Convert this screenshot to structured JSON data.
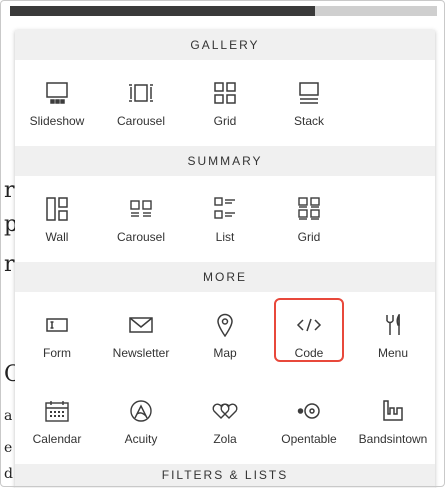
{
  "sections": {
    "gallery": {
      "header": "GALLERY",
      "items": [
        {
          "label": "Slideshow",
          "icon": "slideshow-icon"
        },
        {
          "label": "Carousel",
          "icon": "carousel-icon"
        },
        {
          "label": "Grid",
          "icon": "grid-icon"
        },
        {
          "label": "Stack",
          "icon": "stack-icon"
        }
      ]
    },
    "summary": {
      "header": "SUMMARY",
      "items": [
        {
          "label": "Wall",
          "icon": "wall-icon"
        },
        {
          "label": "Carousel",
          "icon": "summary-carousel-icon"
        },
        {
          "label": "List",
          "icon": "list-icon"
        },
        {
          "label": "Grid",
          "icon": "summary-grid-icon"
        }
      ]
    },
    "more": {
      "header": "MORE",
      "items": [
        {
          "label": "Form",
          "icon": "form-icon"
        },
        {
          "label": "Newsletter",
          "icon": "envelope-icon"
        },
        {
          "label": "Map",
          "icon": "map-pin-icon"
        },
        {
          "label": "Code",
          "icon": "code-icon",
          "highlighted": true
        },
        {
          "label": "Menu",
          "icon": "fork-knife-icon"
        },
        {
          "label": "Calendar",
          "icon": "calendar-icon"
        },
        {
          "label": "Acuity",
          "icon": "acuity-icon"
        },
        {
          "label": "Zola",
          "icon": "zola-icon"
        },
        {
          "label": "Opentable",
          "icon": "opentable-icon"
        },
        {
          "label": "Bandsintown",
          "icon": "bandsintown-icon"
        }
      ]
    },
    "filters": {
      "header": "FILTERS & LISTS"
    }
  },
  "background_glyphs": [
    "r",
    "p",
    "r",
    "O",
    "a",
    "e",
    "d"
  ],
  "colors": {
    "highlight": "#e8483b",
    "section_bg": "#f0f0f0",
    "icon_stroke": "#3c3c3c"
  }
}
